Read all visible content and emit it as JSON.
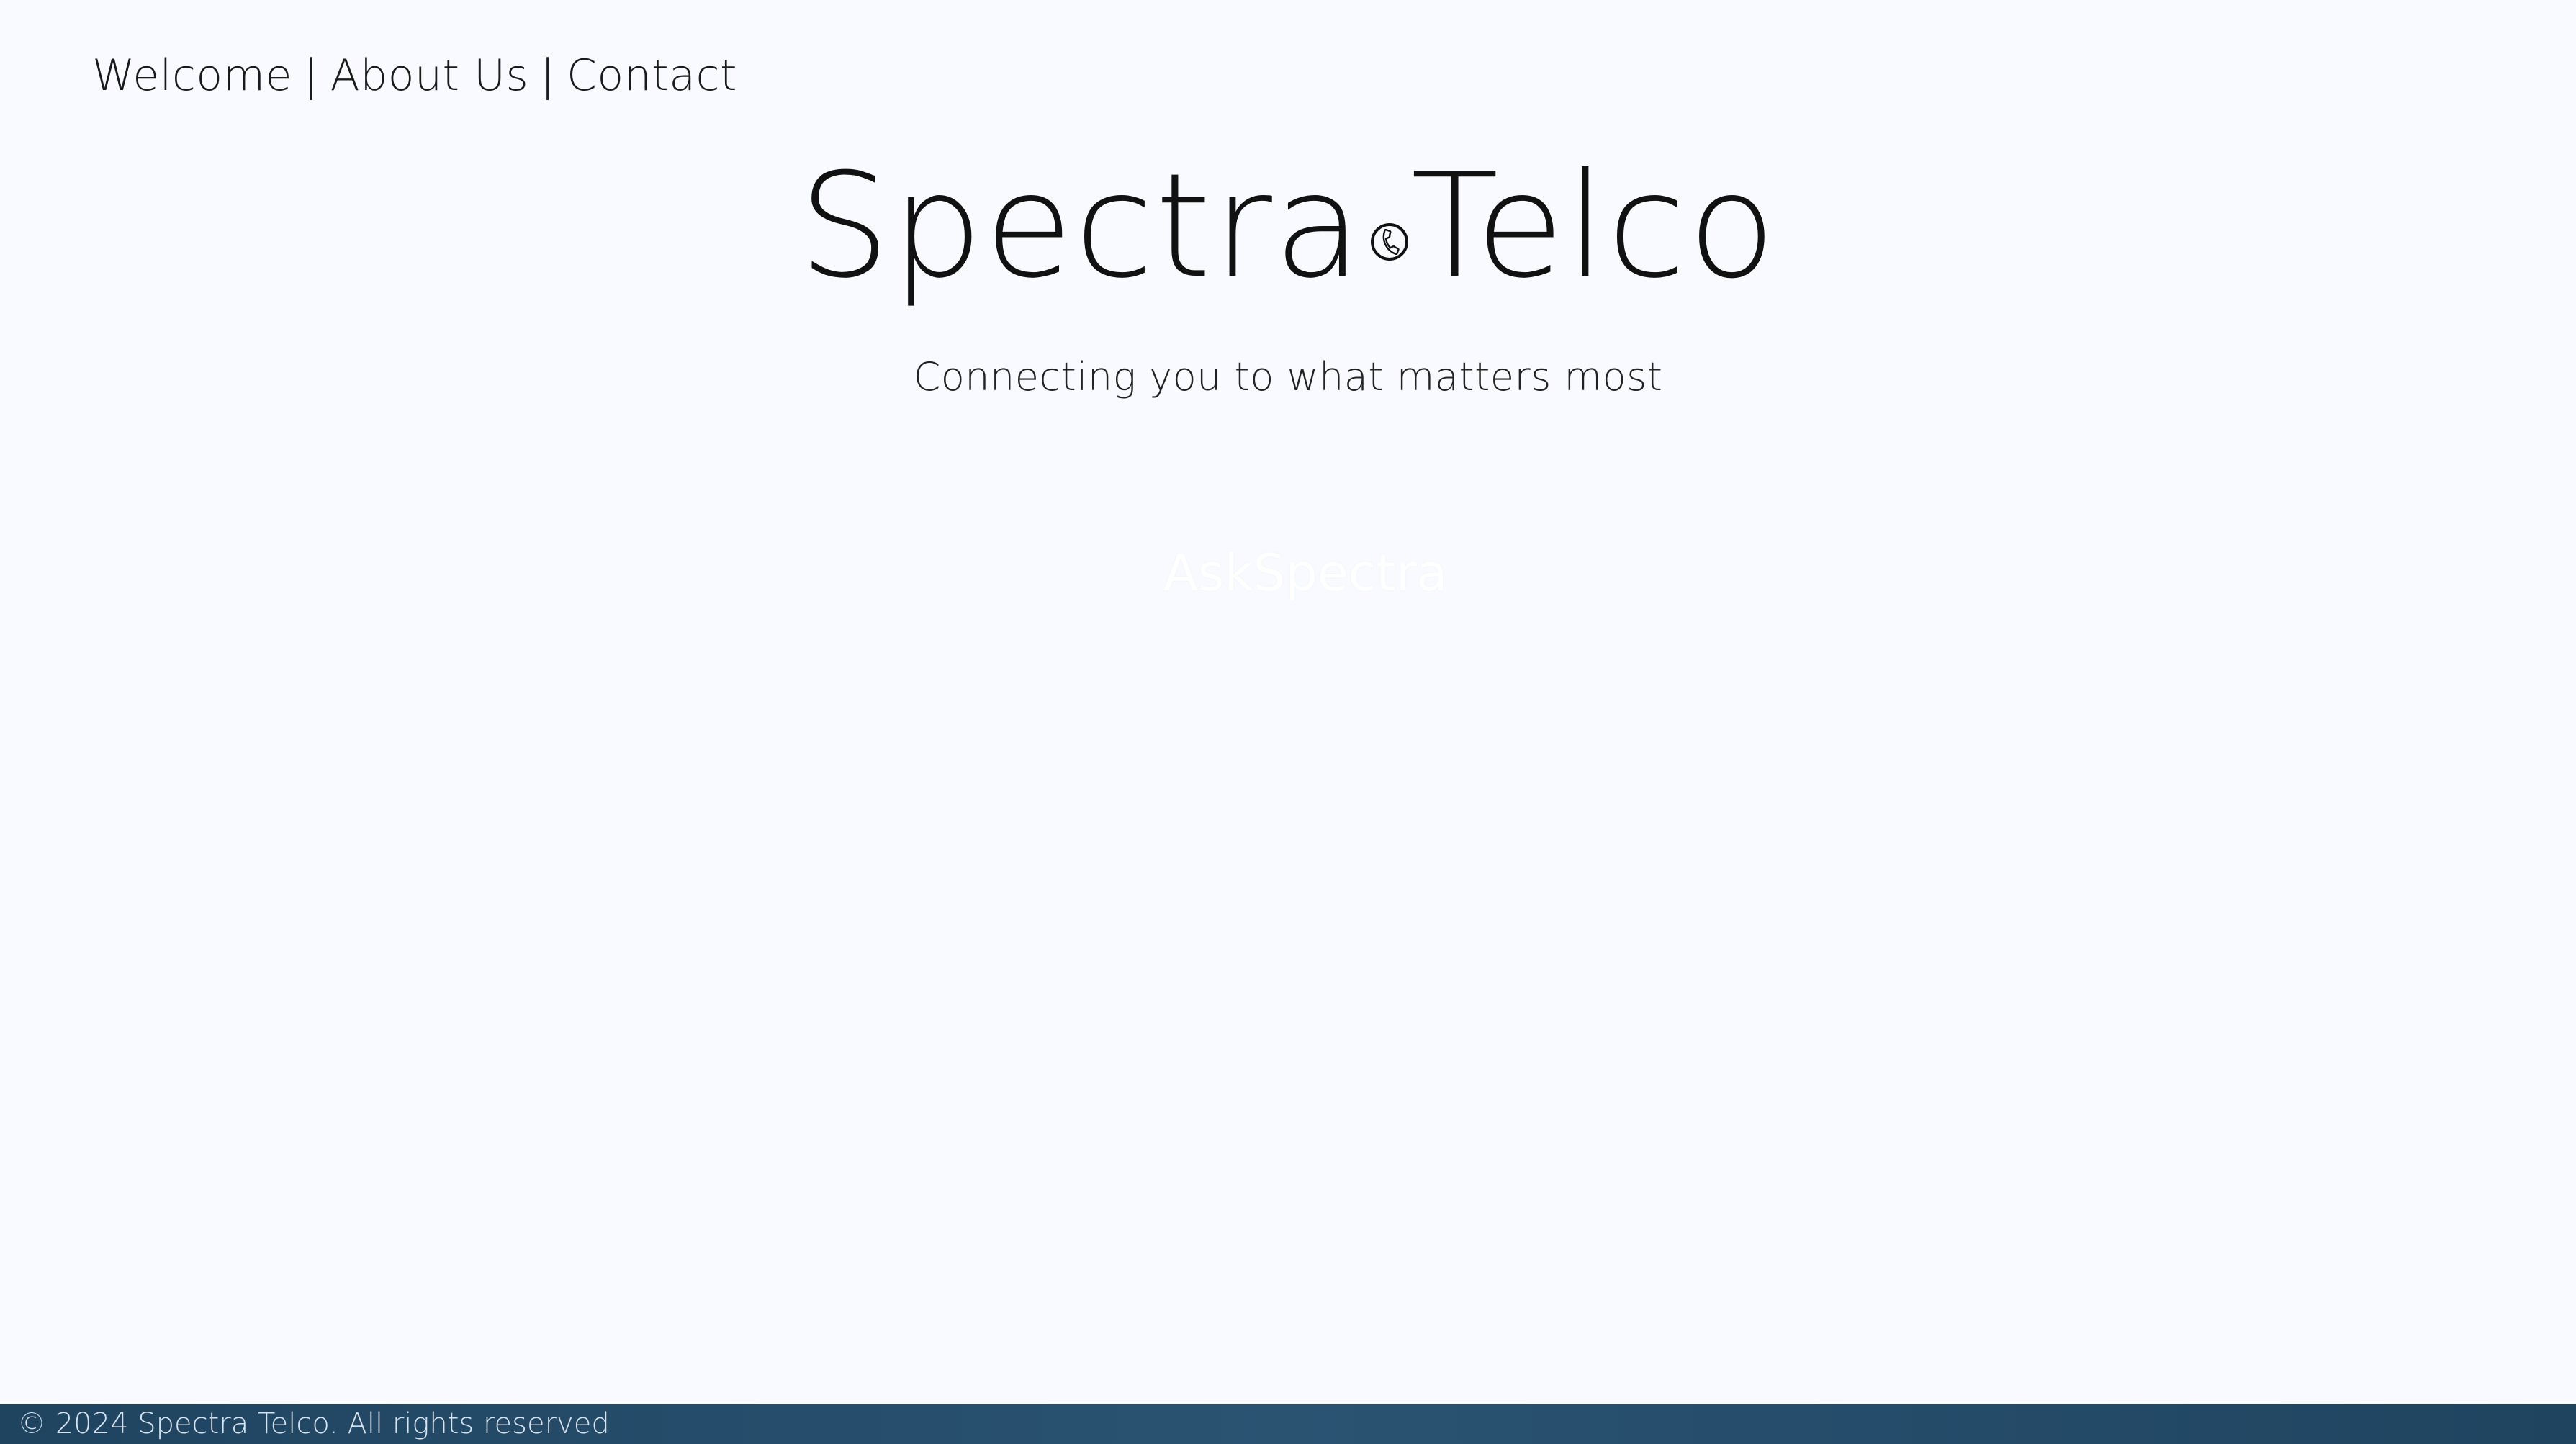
{
  "nav": {
    "welcome": "Welcome",
    "about": "About Us",
    "contact": "Contact",
    "separator": "|"
  },
  "brand": {
    "left": "Spectra",
    "right": "Telco",
    "icon": "phone-icon"
  },
  "tagline": "Connecting you to what matters most",
  "cta": {
    "label": "AskSpectra"
  },
  "footer": {
    "copyright": "© 2024 Spectra Telco. All rights reserved"
  },
  "colors": {
    "background": "#f8faff",
    "footer": "#2a5372",
    "text": "#1a1a1a"
  }
}
